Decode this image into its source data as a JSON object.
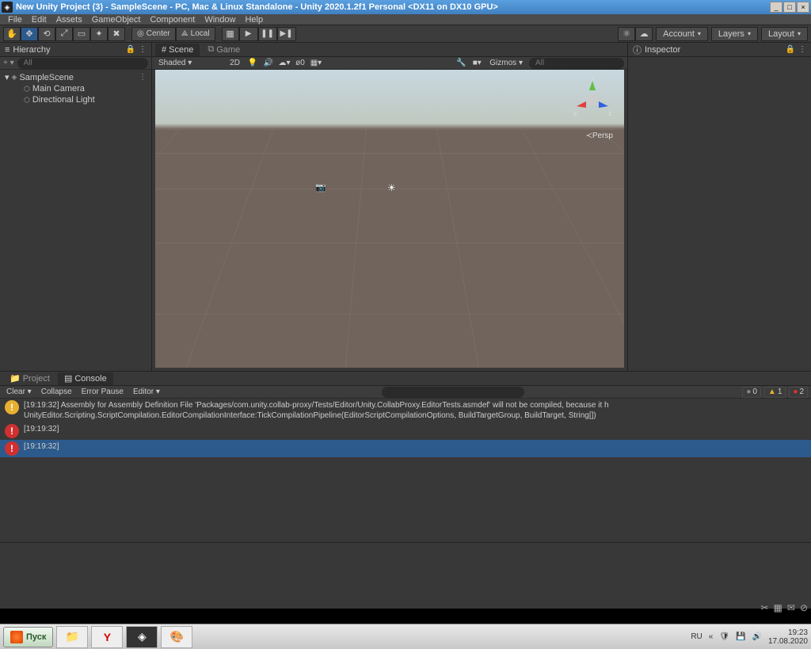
{
  "title": "New Unity Project (3) - SampleScene - PC, Mac & Linux Standalone - Unity 2020.1.2f1 Personal <DX11 on DX10 GPU>",
  "menu": [
    "File",
    "Edit",
    "Assets",
    "GameObject",
    "Component",
    "Window",
    "Help"
  ],
  "toolbar": {
    "center": "Center",
    "local": "Local",
    "account": "Account",
    "layers": "Layers",
    "layout": "Layout"
  },
  "hierarchy": {
    "label": "Hierarchy",
    "search_ph": "All",
    "scene": "SampleScene",
    "items": [
      "Main Camera",
      "Directional Light"
    ]
  },
  "scene": {
    "scene_tab": "Scene",
    "game_tab": "Game",
    "shading": "Shaded",
    "mode2d": "2D",
    "gizmos": "Gizmos",
    "search_ph": "All",
    "persp": "Persp",
    "axes": {
      "x": "x",
      "y": "y",
      "z": "z"
    }
  },
  "inspector": {
    "label": "Inspector"
  },
  "bottom": {
    "project_tab": "Project",
    "console_tab": "Console",
    "clear": "Clear",
    "collapse": "Collapse",
    "error_pause": "Error Pause",
    "editor": "Editor",
    "counts": {
      "info": "0",
      "warn": "1",
      "err": "2"
    },
    "logs": [
      {
        "type": "warn",
        "ts": "[19:19:32]",
        "text": "Assembly for Assembly Definition File 'Packages/com.unity.collab-proxy/Tests/Editor/Unity.CollabProxy.EditorTests.asmdef' will not be compiled, because it h",
        "text2": "UnityEditor.Scripting.ScriptCompilation.EditorCompilationInterface:TickCompilationPipeline(EditorScriptCompilationOptions, BuildTargetGroup, BuildTarget, String[])"
      },
      {
        "type": "err",
        "ts": "[19:19:32]",
        "text": ""
      },
      {
        "type": "err",
        "ts": "[19:19:32]",
        "text": "",
        "selected": true
      }
    ]
  },
  "taskbar": {
    "start": "Пуск",
    "lang": "RU",
    "time": "19:23",
    "date": "17.08.2020"
  }
}
